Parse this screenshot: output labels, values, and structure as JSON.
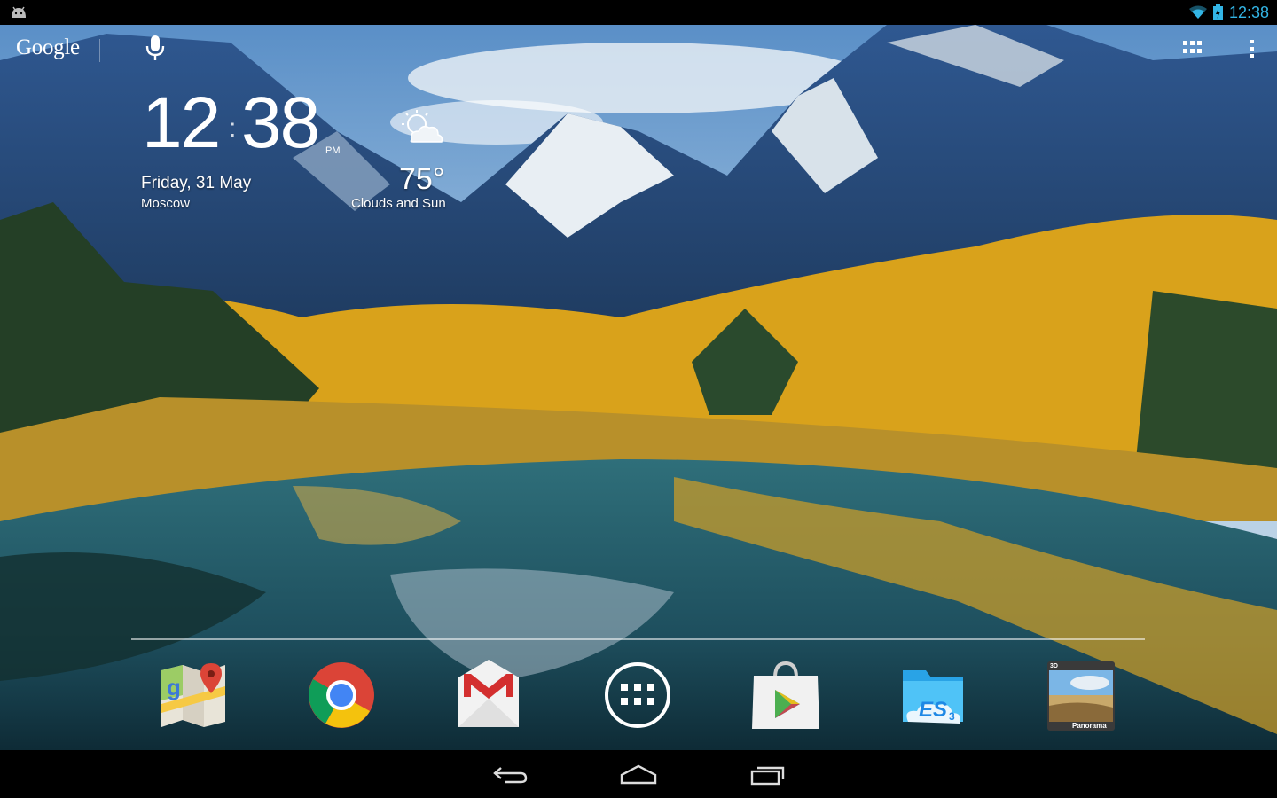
{
  "status_bar": {
    "time": "12:38",
    "icons": [
      "android-notification-icon",
      "wifi-icon",
      "battery-charging-icon"
    ],
    "accent_color": "#33b5e5"
  },
  "search_bar": {
    "logo_text": "Google",
    "icons": [
      "mic-icon",
      "apps-grid-icon",
      "overflow-menu-icon"
    ]
  },
  "clock_widget": {
    "hour": "12",
    "minute": "38",
    "separator": ":",
    "ampm": "PM",
    "date": "Friday, 31 May",
    "city": "Moscow"
  },
  "weather_widget": {
    "temperature": "75°",
    "condition": "Clouds and Sun",
    "icon": "partly-cloudy-icon"
  },
  "dock": {
    "apps": [
      {
        "name": "Maps",
        "icon": "maps-icon"
      },
      {
        "name": "Chrome",
        "icon": "chrome-icon"
      },
      {
        "name": "Gmail",
        "icon": "gmail-icon"
      },
      {
        "name": "All apps",
        "icon": "app-launcher-icon"
      },
      {
        "name": "Play Store",
        "icon": "play-store-icon"
      },
      {
        "name": "ES File Explorer",
        "icon": "es-file-explorer-icon"
      },
      {
        "name": "Panorama",
        "icon": "panorama-icon",
        "badge": "3D",
        "label": "Panorama"
      }
    ]
  },
  "nav_bar": {
    "buttons": [
      "back-icon",
      "home-icon",
      "recents-icon"
    ]
  }
}
